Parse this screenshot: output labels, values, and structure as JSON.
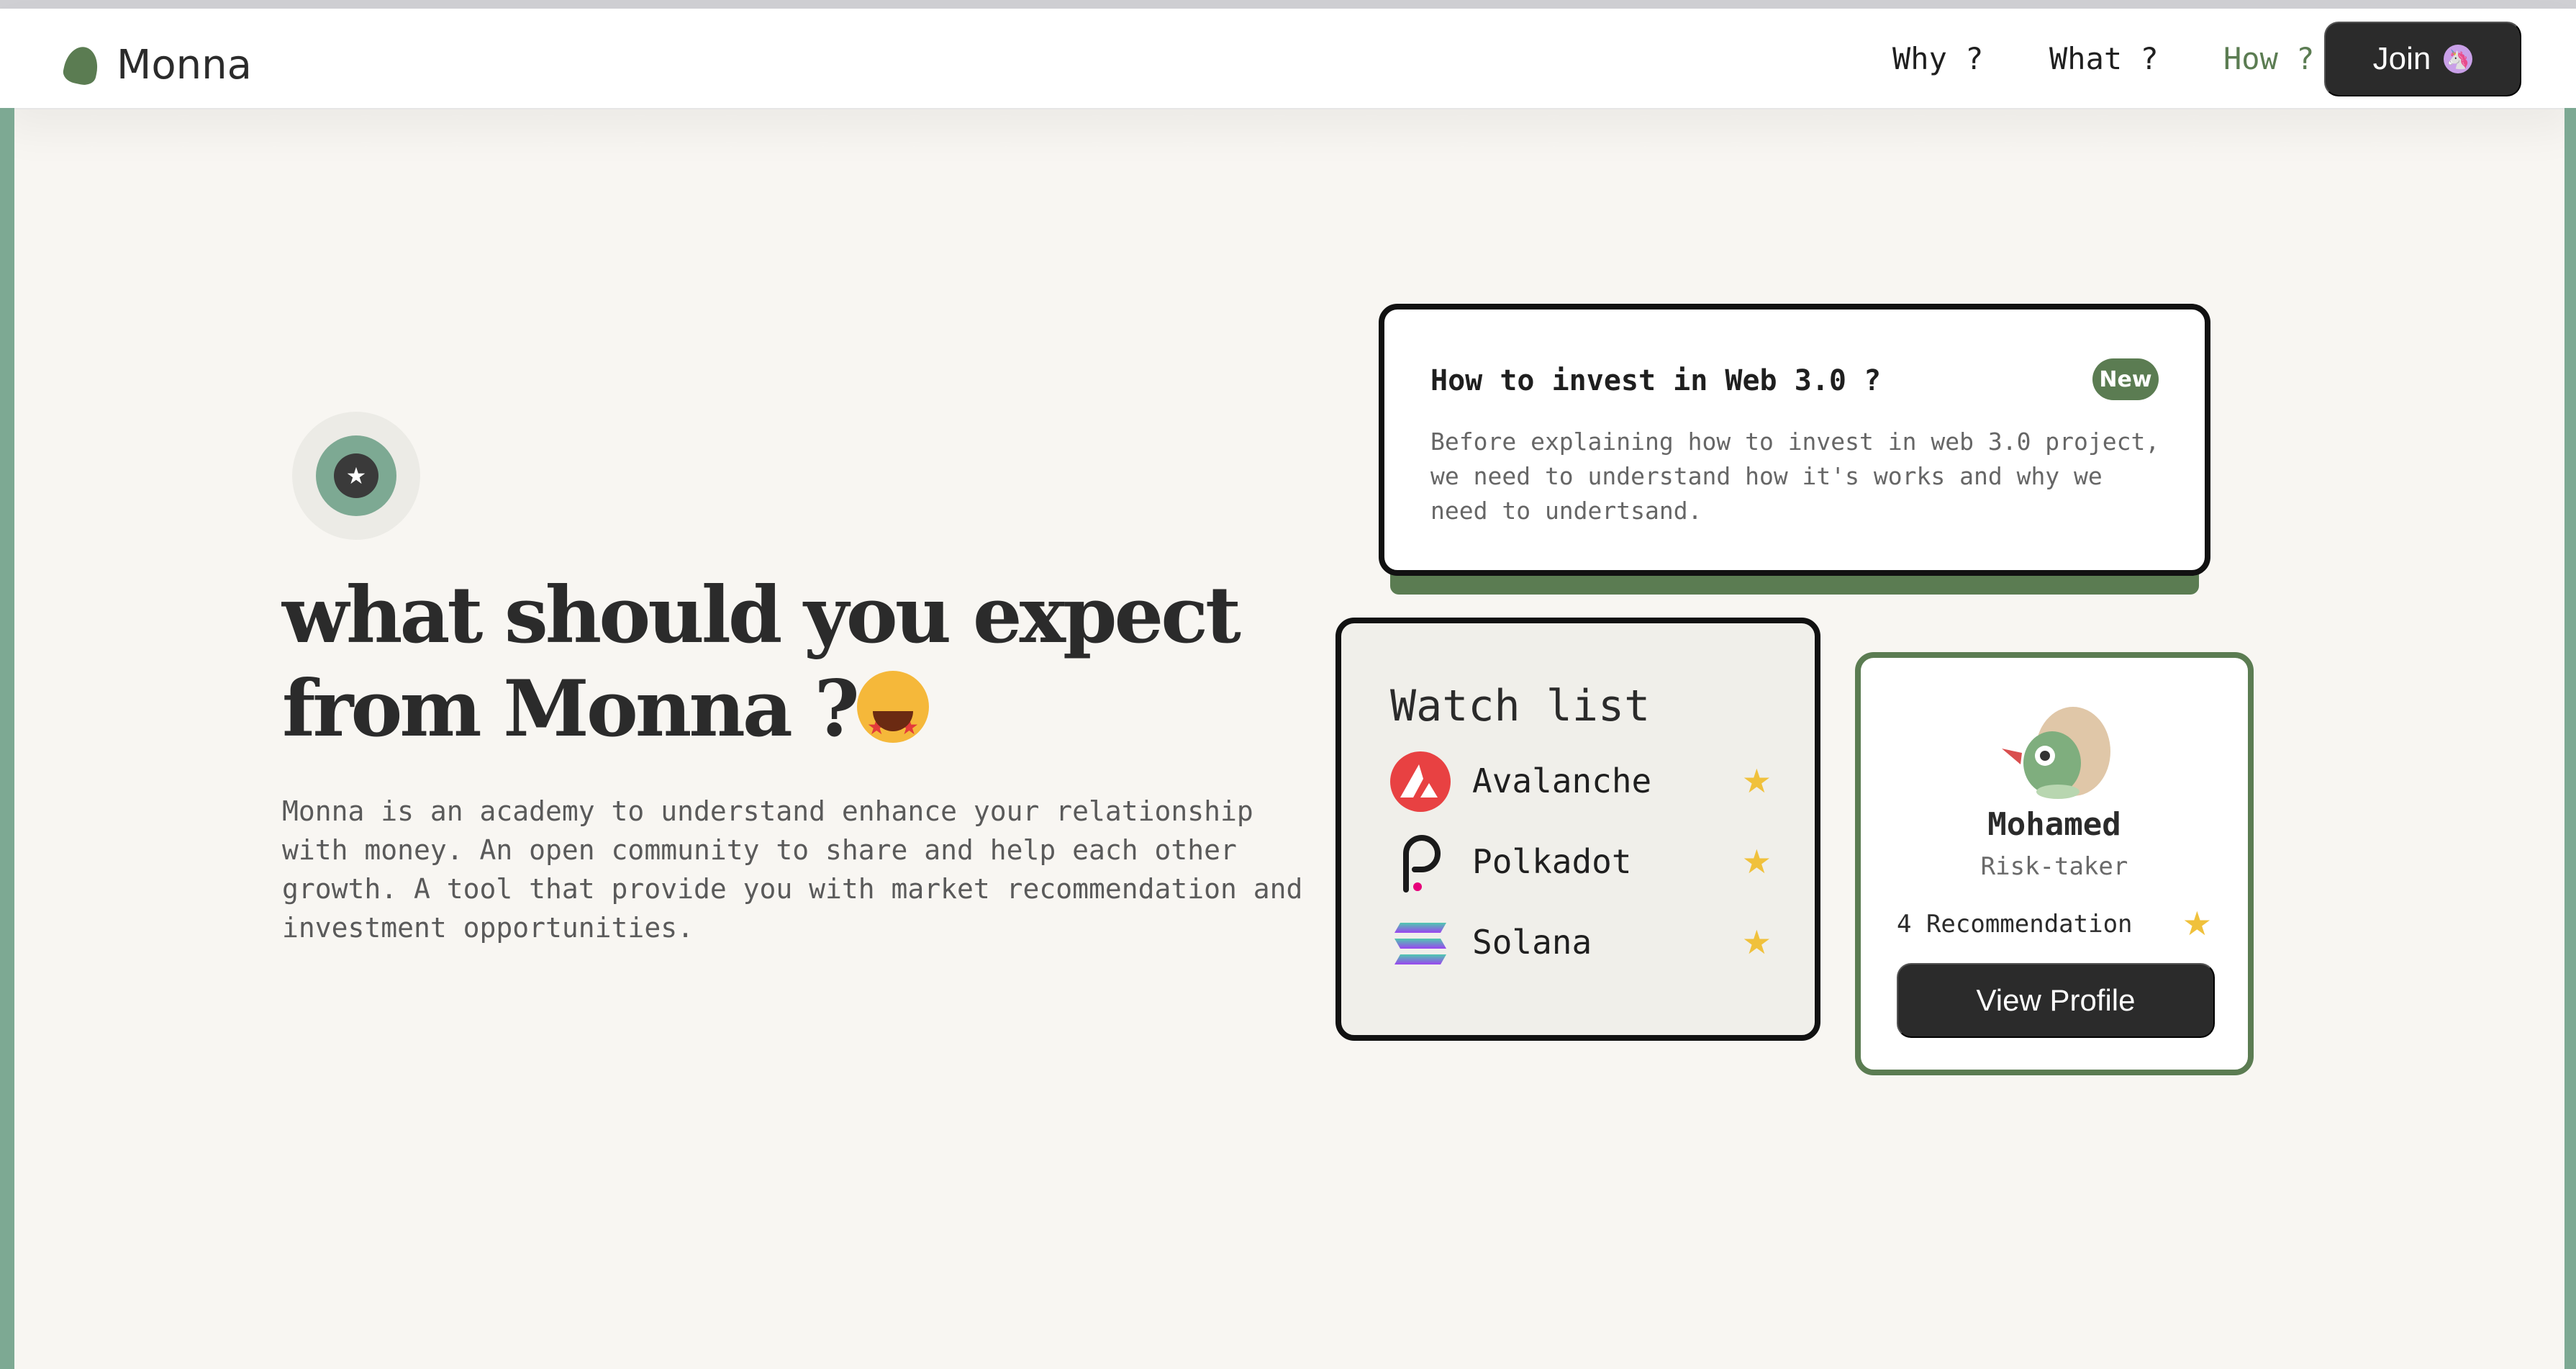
{
  "brand": {
    "name": "Monna"
  },
  "nav": {
    "why": "Why ?",
    "what": "What ?",
    "how": "How ?",
    "join": "Join",
    "join_icon": "unicorn-icon"
  },
  "hero": {
    "badge_icon": "star-icon",
    "title": "what should you expect from Monna ?",
    "title_emoji": "star-struck-emoji",
    "description": "Monna is an academy to understand enhance your relationship with money. An open community to share and help each other growth. A tool that provide you with market recommendation and investment opportunities."
  },
  "article": {
    "title": "How to invest in Web 3.0 ?",
    "badge": "New",
    "body": "Before explaining how to invest in web 3.0 project, we need to understand how it's works and why we need to undertsand."
  },
  "watchlist": {
    "title": "Watch list",
    "items": [
      {
        "name": "Avalanche",
        "icon": "avalanche-logo-icon",
        "starred": true
      },
      {
        "name": "Polkadot",
        "icon": "polkadot-logo-icon",
        "starred": true
      },
      {
        "name": "Solana",
        "icon": "solana-logo-icon",
        "starred": true
      }
    ]
  },
  "profile": {
    "name": "Mohamed",
    "role": "Risk-taker",
    "recommendations": "4 Recommendation",
    "button": "View Profile"
  },
  "colors": {
    "accent_green": "#5b7c52",
    "side_green": "#7da993",
    "dark": "#2b2b2b",
    "star": "#f0c13c",
    "background": "#f8f6f2"
  }
}
